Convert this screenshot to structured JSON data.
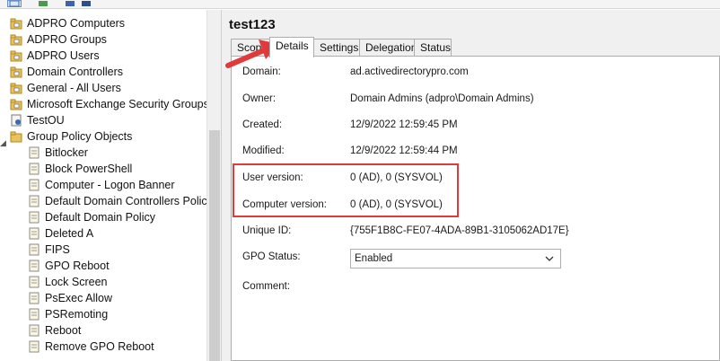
{
  "toolbar": {
    "buttons": [
      "back-icon",
      "refresh-icon",
      "help-icon",
      "list-icon"
    ]
  },
  "tree": {
    "items": [
      {
        "label": "ADPRO Computers",
        "icon": "ou-folder-icon"
      },
      {
        "label": "ADPRO Groups",
        "icon": "ou-folder-icon"
      },
      {
        "label": "ADPRO Users",
        "icon": "ou-folder-icon"
      },
      {
        "label": "Domain Controllers",
        "icon": "ou-folder-icon"
      },
      {
        "label": "General - All Users",
        "icon": "ou-folder-icon"
      },
      {
        "label": "Microsoft Exchange Security Groups",
        "icon": "ou-folder-icon"
      },
      {
        "label": "TestOU",
        "icon": "gpo-link-icon"
      },
      {
        "label": "Group Policy Objects",
        "icon": "gpo-container-icon"
      }
    ],
    "gpos": [
      "Bitlocker",
      "Block PowerShell",
      "Computer - Logon Banner",
      "Default Domain Controllers Policy",
      "Default Domain Policy",
      "Deleted A",
      "FIPS",
      "GPO Reboot",
      "Lock Screen",
      "PsExec Allow",
      "PSRemoting",
      "Reboot",
      "Remove GPO Reboot"
    ]
  },
  "details": {
    "title": "test123",
    "tabs": [
      "Scope",
      "Details",
      "Settings",
      "Delegation",
      "Status"
    ],
    "selected_tab": "Details",
    "fields": {
      "domain_label": "Domain:",
      "domain_value": "ad.activedirectorypro.com",
      "owner_label": "Owner:",
      "owner_value": "Domain Admins (adpro\\Domain Admins)",
      "created_label": "Created:",
      "created_value": "12/9/2022 12:59:45 PM",
      "modified_label": "Modified:",
      "modified_value": "12/9/2022 12:59:44 PM",
      "user_version_label": "User version:",
      "user_version_value": "0 (AD), 0 (SYSVOL)",
      "computer_version_label": "Computer version:",
      "computer_version_value": "0 (AD), 0 (SYSVOL)",
      "unique_id_label": "Unique ID:",
      "unique_id_value": "{755F1B8C-FE07-4ADA-89B1-3105062AD17E}",
      "gpo_status_label": "GPO Status:",
      "gpo_status_value": "Enabled",
      "comment_label": "Comment:"
    }
  },
  "colors": {
    "annotation": "#e03a3a",
    "tab_border": "#adadad",
    "panel_bg": "#ffffff",
    "chrome_bg": "#f0f0f0"
  }
}
